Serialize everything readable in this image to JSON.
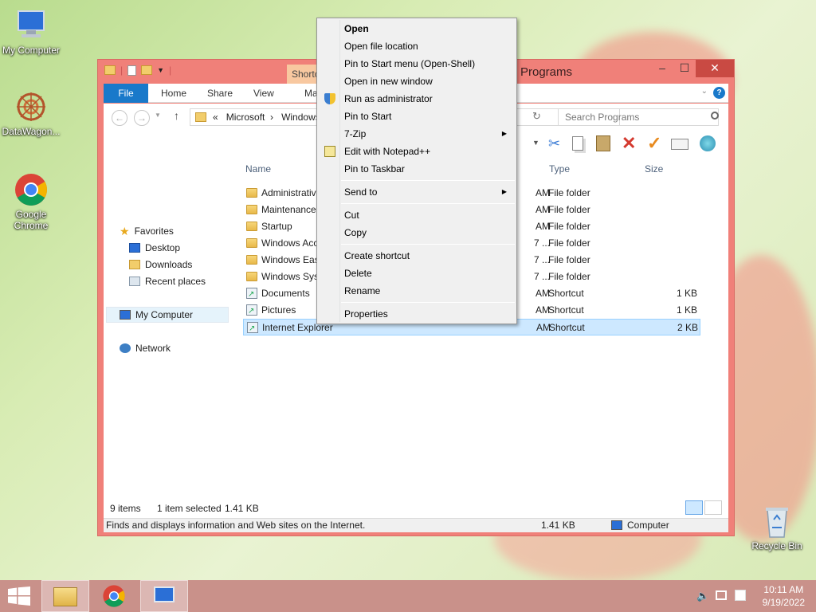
{
  "desktop": {
    "icons": [
      {
        "label": "My Computer"
      },
      {
        "label": "DataWagon..."
      },
      {
        "label": "Google Chrome"
      },
      {
        "label": "Recycle Bin"
      }
    ]
  },
  "window": {
    "title": "Programs",
    "context_tab": "Shortc",
    "tabs": [
      "File",
      "Home",
      "Share",
      "View",
      "Ma"
    ],
    "address": {
      "chevron": "«",
      "parts": [
        "Microsoft",
        "Windows"
      ]
    },
    "search_placeholder": "Search Programs"
  },
  "nav_pane": {
    "favorites": "Favorites",
    "items": [
      "Desktop",
      "Downloads",
      "Recent places"
    ],
    "my_computer": "My Computer",
    "network": "Network"
  },
  "columns": {
    "name": "Name",
    "type": "Type",
    "size": "Size"
  },
  "files": [
    {
      "name": "Administrativ",
      "date": "AM",
      "type": "File folder",
      "size": "",
      "kind": "folder"
    },
    {
      "name": "Maintenance",
      "date": "AM",
      "type": "File folder",
      "size": "",
      "kind": "folder"
    },
    {
      "name": "Startup",
      "date": "AM",
      "type": "File folder",
      "size": "",
      "kind": "folder"
    },
    {
      "name": "Windows Acc",
      "date": "7 ...",
      "type": "File folder",
      "size": "",
      "kind": "folder"
    },
    {
      "name": "Windows Eas",
      "date": "7 ...",
      "type": "File folder",
      "size": "",
      "kind": "folder"
    },
    {
      "name": "Windows Sys",
      "date": "7 ...",
      "type": "File folder",
      "size": "",
      "kind": "folder"
    },
    {
      "name": "Documents",
      "date": "AM",
      "type": "Shortcut",
      "size": "1 KB",
      "kind": "shortcut"
    },
    {
      "name": "Pictures",
      "date": "AM",
      "type": "Shortcut",
      "size": "1 KB",
      "kind": "shortcut"
    },
    {
      "name": "Internet Explorer",
      "date": "AM",
      "type": "Shortcut",
      "size": "2 KB",
      "kind": "shortcut",
      "selected": true
    }
  ],
  "status": {
    "items_count": "9 items",
    "selection": "1 item selected",
    "selection_size": "1.41 KB"
  },
  "infobar": {
    "description": "Finds and displays information and Web sites on the Internet.",
    "size": "1.41 KB",
    "location": "Computer"
  },
  "context_menu": {
    "items": [
      {
        "label": "Open",
        "bold": true
      },
      {
        "label": "Open file location"
      },
      {
        "label": "Pin to Start menu (Open-Shell)"
      },
      {
        "label": "Open in new window"
      },
      {
        "label": "Run as administrator",
        "icon": "shield-icon"
      },
      {
        "label": "Pin to Start"
      },
      {
        "label": "7-Zip",
        "submenu": true
      },
      {
        "label": "Edit with Notepad++",
        "icon": "notepad-icon"
      },
      {
        "label": "Pin to Taskbar"
      },
      {
        "label": "Send to",
        "submenu": true
      },
      {
        "label": "Cut"
      },
      {
        "label": "Copy"
      },
      {
        "label": "Create shortcut"
      },
      {
        "label": "Delete"
      },
      {
        "label": "Rename"
      },
      {
        "label": "Properties"
      }
    ]
  },
  "taskbar": {
    "time": "10:11 AM",
    "date": "9/19/2022"
  }
}
